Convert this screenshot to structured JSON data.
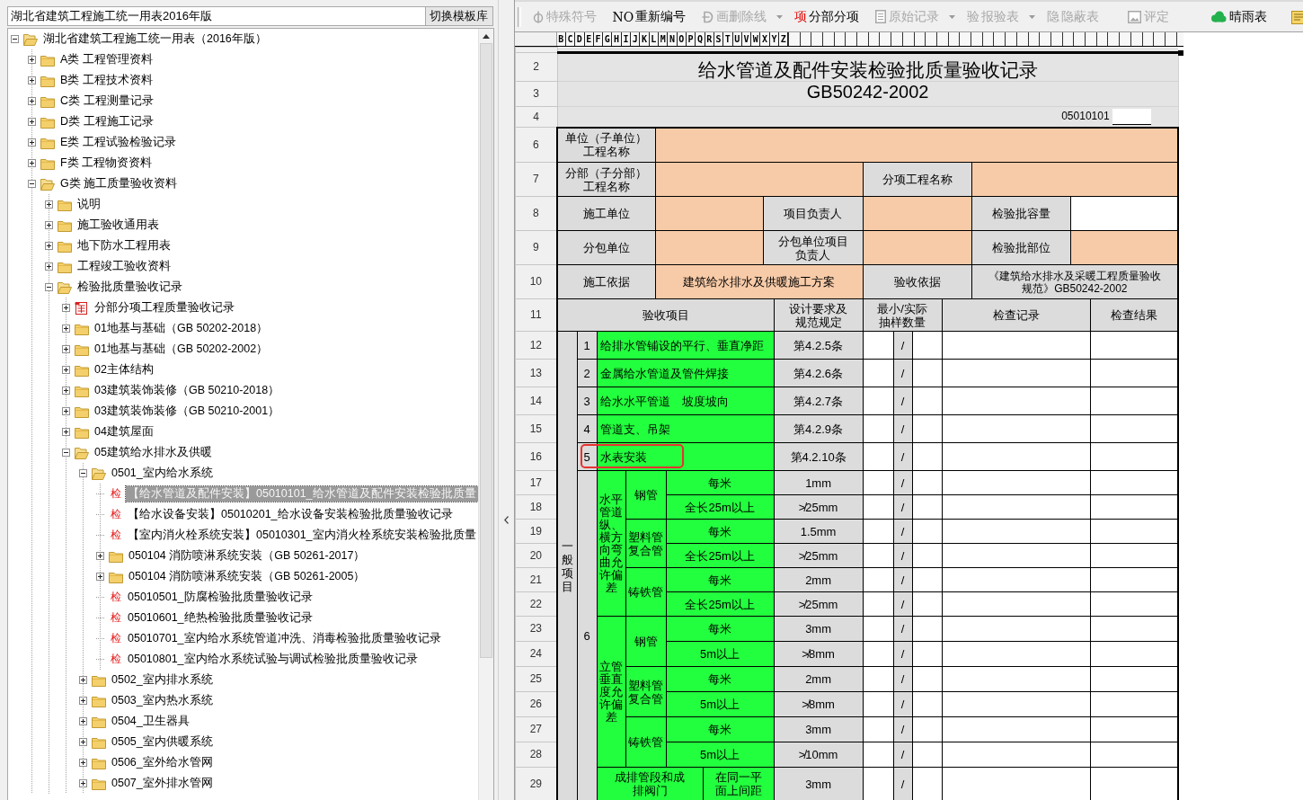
{
  "template_picker": {
    "value": "湖北省建筑工程施工统一用表2016年版",
    "button": "切换模板库"
  },
  "tree": [
    {
      "label": "湖北省建筑工程施工统一用表（2016年版）",
      "kind": "folder",
      "expanded": true,
      "selected": false,
      "children": [
        {
          "label": "A类 工程管理资料",
          "kind": "folder",
          "expanded": false,
          "selected": false
        },
        {
          "label": "B类 工程技术资料",
          "kind": "folder",
          "expanded": false,
          "selected": false
        },
        {
          "label": "C类 工程测量记录",
          "kind": "folder",
          "expanded": false,
          "selected": false
        },
        {
          "label": "D类 工程施工记录",
          "kind": "folder",
          "expanded": false,
          "selected": false
        },
        {
          "label": "E类 工程试验检验记录",
          "kind": "folder",
          "expanded": false,
          "selected": false
        },
        {
          "label": "F类 工程物资资料",
          "kind": "folder",
          "expanded": false,
          "selected": false
        },
        {
          "label": "G类 施工质量验收资料",
          "kind": "folder",
          "expanded": true,
          "selected": false,
          "children": [
            {
              "label": "说明",
              "kind": "folder",
              "expanded": false,
              "selected": false
            },
            {
              "label": "施工验收通用表",
              "kind": "folder",
              "expanded": false,
              "selected": false
            },
            {
              "label": "地下防水工程用表",
              "kind": "folder",
              "expanded": false,
              "selected": false
            },
            {
              "label": "工程竣工验收资料",
              "kind": "folder",
              "expanded": false,
              "selected": false
            },
            {
              "label": "检验批质量验收记录",
              "kind": "folder",
              "expanded": true,
              "selected": false,
              "children": [
                {
                  "label": "分部分项工程质量验收记录",
                  "kind": "form",
                  "expanded": false,
                  "selected": false
                },
                {
                  "label": "01地基与基础（GB 50202-2018）",
                  "kind": "folder",
                  "expanded": false,
                  "selected": false
                },
                {
                  "label": "01地基与基础（GB 50202-2002）",
                  "kind": "folder",
                  "expanded": false,
                  "selected": false
                },
                {
                  "label": "02主体结构",
                  "kind": "folder",
                  "expanded": false,
                  "selected": false
                },
                {
                  "label": "03建筑装饰装修（GB 50210-2018）",
                  "kind": "folder",
                  "expanded": false,
                  "selected": false
                },
                {
                  "label": "03建筑装饰装修（GB 50210-2001）",
                  "kind": "folder",
                  "expanded": false,
                  "selected": false
                },
                {
                  "label": "04建筑屋面",
                  "kind": "folder",
                  "expanded": false,
                  "selected": false
                },
                {
                  "label": "05建筑给水排水及供暖",
                  "kind": "folder",
                  "expanded": true,
                  "selected": false,
                  "children": [
                    {
                      "label": "0501_室内给水系统",
                      "kind": "folder",
                      "expanded": true,
                      "selected": false,
                      "children": [
                        {
                          "label": "【给水管道及配件安装】05010101_给水管道及配件安装检验批质量",
                          "kind": "record",
                          "badge": "检",
                          "selected": true
                        },
                        {
                          "label": "【给水设备安装】05010201_给水设备安装检验批质量验收记录",
                          "kind": "record",
                          "badge": "检",
                          "selected": false
                        },
                        {
                          "label": "【室内消火栓系统安装】05010301_室内消火栓系统安装检验批质量",
                          "kind": "record",
                          "badge": "检",
                          "selected": false
                        },
                        {
                          "label": "050104 消防喷淋系统安装（GB 50261-2017）",
                          "kind": "folder",
                          "expanded": false,
                          "selected": false
                        },
                        {
                          "label": "050104 消防喷淋系统安装（GB 50261-2005）",
                          "kind": "folder",
                          "expanded": false,
                          "selected": false
                        },
                        {
                          "label": "05010501_防腐检验批质量验收记录",
                          "kind": "record",
                          "badge": "检",
                          "selected": false
                        },
                        {
                          "label": "05010601_绝热检验批质量验收记录",
                          "kind": "record",
                          "badge": "检",
                          "selected": false
                        },
                        {
                          "label": "05010701_室内给水系统管道冲洗、消毒检验批质量验收记录",
                          "kind": "record",
                          "badge": "检",
                          "selected": false
                        },
                        {
                          "label": "05010801_室内给水系统试验与调试检验批质量验收记录",
                          "kind": "record",
                          "badge": "检",
                          "selected": false
                        }
                      ]
                    },
                    {
                      "label": "0502_室内排水系统",
                      "kind": "folder",
                      "expanded": false,
                      "selected": false
                    },
                    {
                      "label": "0503_室内热水系统",
                      "kind": "folder",
                      "expanded": false,
                      "selected": false
                    },
                    {
                      "label": "0504_卫生器具",
                      "kind": "folder",
                      "expanded": false,
                      "selected": false
                    },
                    {
                      "label": "0505_室内供暖系统",
                      "kind": "folder",
                      "expanded": false,
                      "selected": false
                    },
                    {
                      "label": "0506_室外给水管网",
                      "kind": "folder",
                      "expanded": false,
                      "selected": false
                    },
                    {
                      "label": "0507_室外排水管网",
                      "kind": "folder",
                      "expanded": false,
                      "selected": false
                    }
                  ]
                }
              ]
            }
          ]
        }
      ]
    }
  ],
  "toolbar": [
    {
      "kind": "icon",
      "label": "特殊符号",
      "disabled": true,
      "menu": false
    },
    {
      "kind": "glyph",
      "glyph": "NO",
      "label": "重新编号",
      "disabled": false,
      "menu": false
    },
    {
      "kind": "icon",
      "label": "画删除线",
      "disabled": true,
      "menu": true
    },
    {
      "kind": "glyph",
      "glyph": "项",
      "label": "分部分项",
      "disabled": false,
      "menu": false,
      "color": "#e00000"
    },
    {
      "kind": "icon",
      "label": "原始记录",
      "disabled": true,
      "menu": true
    },
    {
      "kind": "glyph",
      "glyph": "验",
      "label": "报验表",
      "disabled": true,
      "menu": true
    },
    {
      "kind": "glyph",
      "glyph": "隐",
      "label": "隐蔽表",
      "disabled": true,
      "menu": false
    },
    {
      "kind": "icon",
      "label": "评定",
      "disabled": true,
      "menu": false
    },
    {
      "kind": "icon",
      "label": "晴雨表",
      "disabled": false,
      "menu": false
    }
  ],
  "sheet": {
    "columns": [
      "B",
      "C",
      "D",
      "E",
      "F",
      "G",
      "H",
      "I",
      "J",
      "K",
      "L",
      "M",
      "N",
      "O",
      "P",
      "Q",
      "R",
      "S",
      "T",
      "U",
      "V",
      "W",
      "X",
      "Y",
      "Z"
    ],
    "row_numbers": [
      "2",
      "3",
      "4",
      "6",
      "7",
      "8",
      "9",
      "10",
      "11",
      "12",
      "13",
      "14",
      "15",
      "16",
      "17",
      "18",
      "19",
      "20",
      "21",
      "22",
      "23",
      "24",
      "25",
      "26",
      "27",
      "28",
      "29"
    ],
    "title": "给水管道及配件安装检验批质量验收记录",
    "standard": "GB50242-2002",
    "form_code": "05010101",
    "info_rows": [
      [
        {
          "kind": "label",
          "text": "单位（子单位）工程名称"
        },
        {
          "kind": "field",
          "highlighted": true
        }
      ],
      [
        {
          "kind": "label",
          "text": "分部（子分部）工程名称"
        },
        {
          "kind": "field",
          "highlighted": true
        },
        {
          "kind": "label",
          "text": "分项工程名称"
        },
        {
          "kind": "field",
          "highlighted": true
        }
      ],
      [
        {
          "kind": "label",
          "text": "施工单位"
        },
        {
          "kind": "field",
          "highlighted": true
        },
        {
          "kind": "label",
          "text": "项目负责人"
        },
        {
          "kind": "field",
          "highlighted": true
        },
        {
          "kind": "label",
          "text": "检验批容量"
        },
        {
          "kind": "field",
          "highlighted": false
        }
      ],
      [
        {
          "kind": "label",
          "text": "分包单位"
        },
        {
          "kind": "field",
          "highlighted": true
        },
        {
          "kind": "label",
          "text": "分包单位项目负责人"
        },
        {
          "kind": "field",
          "highlighted": true
        },
        {
          "kind": "label",
          "text": "检验批部位"
        },
        {
          "kind": "field",
          "highlighted": true
        }
      ],
      [
        {
          "kind": "label",
          "text": "施工依据"
        },
        {
          "kind": "field",
          "highlighted": true,
          "value": "建筑给水排水及供暖施工方案"
        },
        {
          "kind": "label",
          "text": "验收依据"
        },
        {
          "kind": "label",
          "text": "《建筑给水排水及采暖工程质量验收规范》GB50242-2002"
        }
      ]
    ],
    "headings": [
      "验收项目",
      "设计要求及规范规定",
      "最小/实际抽样数量",
      "检查记录",
      "检查结果"
    ],
    "general": {
      "label": "一般项目",
      "items": [
        {
          "number": "1",
          "name": "给排水管铺设的平行、垂直净距",
          "spec": "第4.2.5条",
          "sample": "/",
          "marked": false
        },
        {
          "number": "2",
          "name": "金属给水管道及管件焊接",
          "spec": "第4.2.6条",
          "sample": "/",
          "marked": false
        },
        {
          "number": "3",
          "name": "给水水平管道　坡度坡向",
          "spec": "第4.2.7条",
          "sample": "/",
          "marked": false
        },
        {
          "number": "4",
          "name": "管道支、吊架",
          "spec": "第4.2.9条",
          "sample": "/",
          "marked": false
        },
        {
          "number": "5",
          "name": "水表安装",
          "spec": "第4.2.10条",
          "sample": "/",
          "marked": true
        }
      ],
      "deviation": {
        "number": "6",
        "groups": [
          {
            "kind": "nested",
            "name": "水平管道纵、横方向弯曲允许偏差",
            "pipes": [
              {
                "name": "钢管",
                "checks": [
                  {
                    "measure": "每米",
                    "spec": "1mm",
                    "sample": "/"
                  },
                  {
                    "measure": "全长25m以上",
                    "spec": "≯25mm",
                    "sample": "/"
                  }
                ]
              },
              {
                "name": "塑料管复合管",
                "checks": [
                  {
                    "measure": "每米",
                    "spec": "1.5mm",
                    "sample": "/"
                  },
                  {
                    "measure": "全长25m以上",
                    "spec": "≯25mm",
                    "sample": "/"
                  }
                ]
              },
              {
                "name": "铸铁管",
                "checks": [
                  {
                    "measure": "每米",
                    "spec": "2mm",
                    "sample": "/"
                  },
                  {
                    "measure": "全长25m以上",
                    "spec": "≯25mm",
                    "sample": "/"
                  }
                ]
              }
            ]
          },
          {
            "kind": "nested",
            "name": "立管垂直度允许偏差",
            "pipes": [
              {
                "name": "钢管",
                "checks": [
                  {
                    "measure": "每米",
                    "spec": "3mm",
                    "sample": "/"
                  },
                  {
                    "measure": "5m以上",
                    "spec": "≯8mm",
                    "sample": "/"
                  }
                ]
              },
              {
                "name": "塑料管复合管",
                "checks": [
                  {
                    "measure": "每米",
                    "spec": "2mm",
                    "sample": "/"
                  },
                  {
                    "measure": "5m以上",
                    "spec": "≯8mm",
                    "sample": "/"
                  }
                ]
              },
              {
                "name": "铸铁管",
                "checks": [
                  {
                    "measure": "每米",
                    "spec": "3mm",
                    "sample": "/"
                  },
                  {
                    "measure": "5m以上",
                    "spec": "≯10mm",
                    "sample": "/"
                  }
                ]
              }
            ]
          },
          {
            "kind": "single",
            "name": "成排管段和成排阀门",
            "condition": "在同一平面上间距",
            "spec": "3mm",
            "sample": "/"
          }
        ]
      }
    }
  }
}
